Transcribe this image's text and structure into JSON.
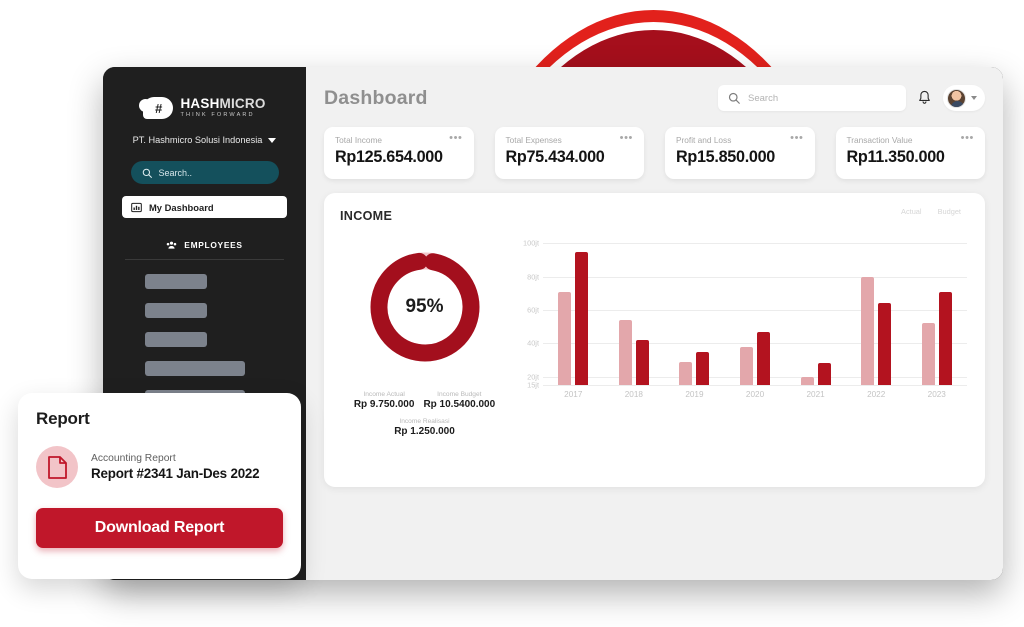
{
  "decor": {
    "outer_ring_color": "#e2211c",
    "inner_circle_color": "#a50f1c"
  },
  "sidebar": {
    "logo": {
      "name_bold": "HASH",
      "name_light": "MICRO",
      "tagline": "THINK FORWARD",
      "mark_glyph": "#"
    },
    "company": "PT. Hashmicro Solusi Indonesia",
    "search_placeholder": "Search..",
    "active_item": "My Dashboard",
    "section_label": "EMPLOYEES",
    "skeleton_widths": [
      62,
      62,
      62,
      100,
      100
    ]
  },
  "header": {
    "title": "Dashboard",
    "search_placeholder": "Search",
    "icons": {
      "bell": "bell-icon",
      "avatar": "avatar",
      "chevron": "chevron-down-icon"
    }
  },
  "stats": [
    {
      "label": "Total Income",
      "value": "Rp125.654.000"
    },
    {
      "label": "Total Expenses",
      "value": "Rp75.434.000"
    },
    {
      "label": "Profit and Loss",
      "value": "Rp15.850.000"
    },
    {
      "label": "Transaction Value",
      "value": "Rp11.350.000"
    }
  ],
  "income": {
    "title": "INCOME",
    "donut": {
      "percent_label": "95%",
      "percent": 95,
      "track_color": "#f0c6ca",
      "fill_color": "#a30f1d"
    },
    "figures": [
      {
        "caption": "Income Actual",
        "value": "Rp 9.750.000"
      },
      {
        "caption": "Income Budget",
        "value": "Rp 10.5400.000"
      },
      {
        "caption": "Income Realisasi",
        "value": "Rp 1.250.000"
      }
    ]
  },
  "chart_data": {
    "type": "bar",
    "title": "INCOME",
    "xlabel": "",
    "ylabel": "",
    "categories": [
      "2017",
      "2018",
      "2019",
      "2020",
      "2021",
      "2022",
      "2023"
    ],
    "series": [
      {
        "name": "Actual",
        "color": "#e3a7ab",
        "values": [
          71,
          54,
          29,
          38,
          20,
          80,
          52
        ]
      },
      {
        "name": "Budget",
        "color": "#b3131f",
        "values": [
          95,
          42,
          35,
          47,
          28,
          64,
          71
        ]
      }
    ],
    "ytick_labels": [
      "100jt",
      "80jt",
      "60jt",
      "40jt",
      "20jt",
      "15jt"
    ],
    "ytick_values": [
      100,
      80,
      60,
      40,
      20,
      15
    ],
    "ylim": [
      15,
      108
    ],
    "grid": true,
    "legend_position": "top-right"
  },
  "report": {
    "title": "Report",
    "subtitle": "Accounting Report",
    "name": "Report #2341 Jan-Des 2022",
    "button_label": "Download Report",
    "icon": "document-icon"
  }
}
